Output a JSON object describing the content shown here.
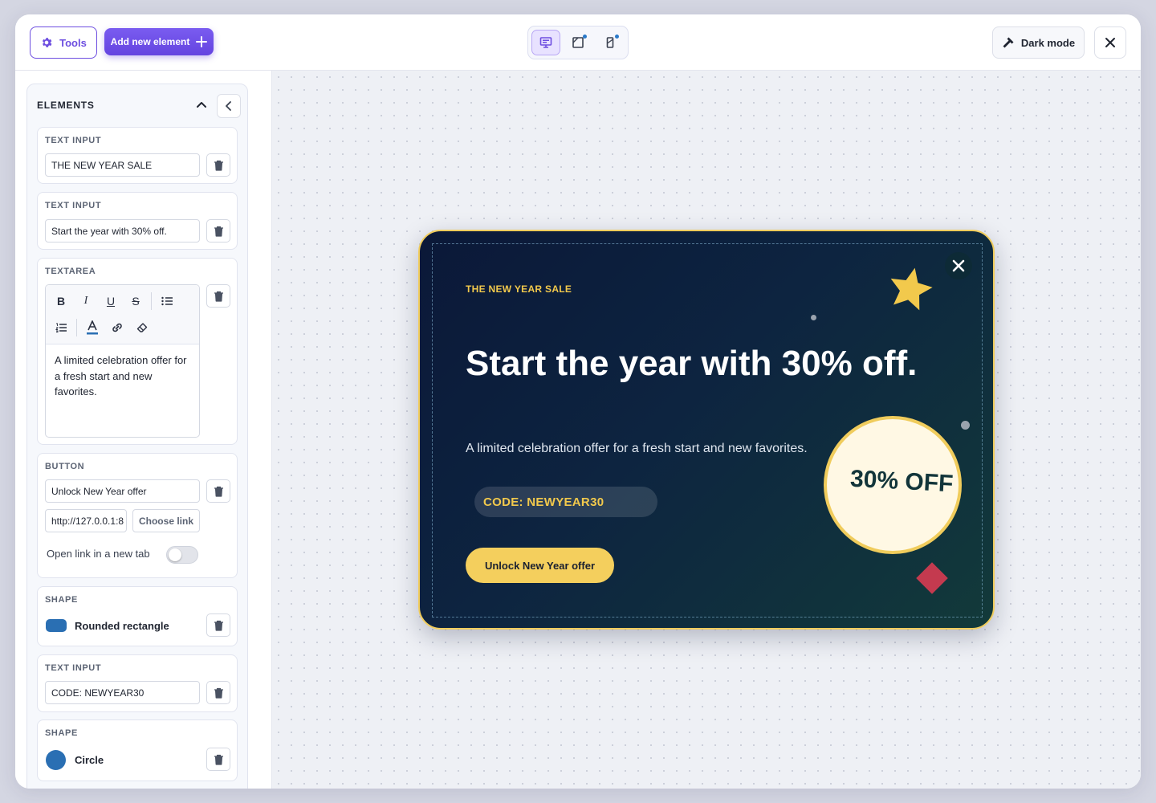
{
  "toolbar": {
    "tools_label": "Tools",
    "add_label": "Add new element",
    "dark_mode_label": "Dark mode"
  },
  "sidebar": {
    "title": "ELEMENTS",
    "cards": {
      "text1": {
        "type": "TEXT INPUT",
        "value": "THE NEW YEAR SALE"
      },
      "text2": {
        "type": "TEXT INPUT",
        "value": "Start the year with 30% off."
      },
      "textarea": {
        "type": "TEXTAREA",
        "tools": [
          "B",
          "I",
          "U",
          "S"
        ],
        "value": "A limited celebration offer for a fresh start and new favorites."
      },
      "button": {
        "type": "BUTTON",
        "label_value": "Unlock New Year offer",
        "link_value": "http://127.0.0.1:8",
        "choose_link": "Choose link",
        "toggle_label": "Open link in a new tab"
      },
      "shape1": {
        "type": "SHAPE",
        "name": "Rounded rectangle"
      },
      "text3": {
        "type": "TEXT INPUT",
        "value": "CODE: NEWYEAR30"
      },
      "shape2": {
        "type": "SHAPE",
        "name": "Circle"
      }
    }
  },
  "popup": {
    "eyebrow": "THE NEW YEAR SALE",
    "headline": "Start the year with 30% off.",
    "subtext": "A limited celebration offer for a fresh start and new favorites.",
    "code": "CODE: NEWYEAR30",
    "cta": "Unlock New Year offer",
    "badge": "30% OFF"
  },
  "colors": {
    "accent": "#6d4ee0",
    "popup_gold": "#f2c94c",
    "popup_bg": "#0b1838",
    "shape_blue": "#2a6fb3",
    "diamond_red": "#c43a4f"
  },
  "icons": {
    "tools": "gear-icon",
    "add": "plus-icon",
    "desktop": "desktop-icon",
    "tablet": "tablet-icon",
    "mobile": "mobile-icon",
    "dark_mode": "hammer-icon",
    "close": "close-icon",
    "delete": "trash-icon"
  }
}
